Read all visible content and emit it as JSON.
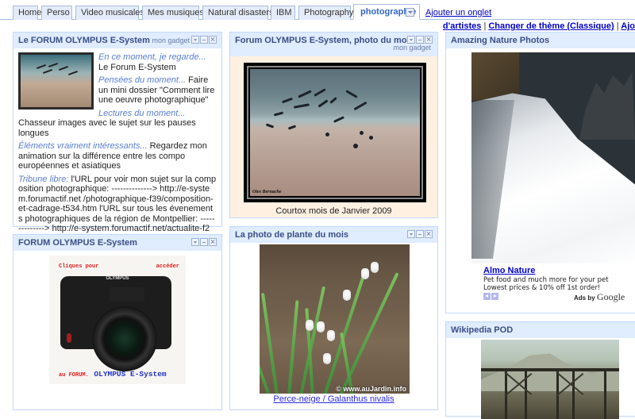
{
  "tabs": [
    {
      "label": "Home"
    },
    {
      "label": "Perso"
    },
    {
      "label": "Video musicales"
    },
    {
      "label": "Mes musiques"
    },
    {
      "label": "Natural disasters"
    },
    {
      "label": "IBM"
    },
    {
      "label": "Photography"
    },
    {
      "label": "photographie",
      "active": true
    }
  ],
  "add_tab_label": "Ajouter un onglet",
  "top_links": {
    "artists": "d'artistes",
    "sep1": "|",
    "theme": "Changer de thème (Classique)",
    "sep2": "|",
    "add": "Ajo"
  },
  "gadgets": {
    "forum_text": {
      "title": "Le FORUM OLYMPUS E-System",
      "mon_gadget": "mon gadget",
      "entries": [
        {
          "label": "En ce moment, je regarde...",
          "text": " Le Forum E-System"
        },
        {
          "label": "Pensées du moment...",
          "text": " Faire un mini dossier \"Comment lire une oeuvre photographique\""
        },
        {
          "label": "Lectures du moment...",
          "text": " Chasseur images avec le sujet sur les pauses longues"
        },
        {
          "label": "Éléments vraiment intéressants...",
          "text": " Regardez mon animation sur la différence entre les compo européennes et asiatiques"
        },
        {
          "label": "Tribune libre:",
          "text": " l'URL pour voir mon sujet sur la composition photographique: --------------> http://e-system.forumactif.net /photographique-f39/composition-et-cadrage-t534.htm l'URL sur tous les évenements photographiques de la région de Montpellier: --------------> http://e-system.forumactif.net/actualite-f29/les-expositions-et-evenements-photos-a-montpellier-t521.htm Alors ce gadget il est pas mal, non?"
        }
      ]
    },
    "forum_camera": {
      "title": "FORUM OLYMPUS E-System",
      "image_text_left": "Cliques pour",
      "image_text_right": "accéder",
      "image_text_bottom_a": "au FORUM.",
      "image_text_bottom_b": "OLYMPUS E-System",
      "brand": "OLYMPUS"
    },
    "photo_du_mois": {
      "title": "Forum OLYMPUS E-System, photo du mois",
      "mon_gadget": "mon gadget",
      "signature": "Oies Bernache",
      "caption": "Courtox mois de Janvier 2009"
    },
    "plante_du_mois": {
      "title": "La photo de plante du mois",
      "credit": "© www.auJardin.info",
      "caption": "Perce-neige / Galanthus nivalis"
    },
    "amazing_nature": {
      "title": "Amazing Nature Photos",
      "ad": {
        "title": "Almo Nature",
        "line1": "Pet food and much more for your pet",
        "line2": "Lowest prices & 10% off 1st order!",
        "ads_by": "Ads by",
        "google": "Google"
      }
    },
    "wikipedia_pod": {
      "title": "Wikipedia POD"
    }
  },
  "colors": {
    "gadget_header_bg": "#e0ecff",
    "gadget_border": "#c3d9ff",
    "gadget_title": "#3b4e86",
    "link": "#0000cc",
    "label_italic": "#5a7fd0",
    "photo_du_mois_bg": "#fff0e1"
  }
}
